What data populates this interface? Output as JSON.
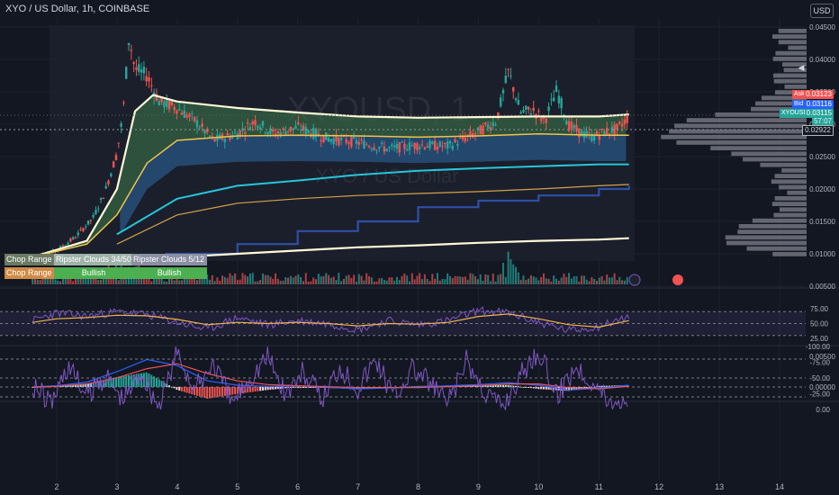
{
  "header": {
    "title": "XYO / US Dollar, 1h, COINBASE",
    "currency_button": "USD"
  },
  "watermark": {
    "ticker": "XYOUSD, 1",
    "name": "XYO / US Dollar"
  },
  "price_tags": {
    "ask_label": "Ask",
    "ask_value": "0.03123",
    "bid_label": "Bid",
    "bid_value": "0.03116",
    "symbol_label": "XYOUSD",
    "last_value": "0.03115",
    "countdown": "57:07",
    "line_value": "0.02922"
  },
  "overlay_table": {
    "row1": [
      "Chop Range",
      "Ripster Clouds 34/50",
      "Ripster Clouds 5/12"
    ],
    "row2": [
      "Chop Range",
      "Bullish",
      "Bullish"
    ]
  },
  "colors": {
    "background": "#131722",
    "grid": "#1e222d",
    "up": "#26a69a",
    "down": "#ef5350",
    "cloud_green": "#3d7a4a",
    "cloud_blue": "#2e6fb0",
    "ema_white": "#fff9d8",
    "ema_yellow": "#f0c44a",
    "cyan": "#26c6da",
    "navy": "#2f4fa8",
    "rsi": "#7e57c2",
    "rsi_signal": "#f0b44a",
    "macd": "#2962ff",
    "macd_signal": "#ef5350",
    "ask": "#ef5350",
    "bid": "#2962ff",
    "last": "#26a69a"
  },
  "chart_data": [
    {
      "type": "line",
      "name": "price",
      "x_labels": [
        "2",
        "3",
        "4",
        "5",
        "6",
        "7",
        "8",
        "9",
        "10",
        "11",
        "12",
        "13",
        "14"
      ],
      "y_labels": [
        "0.04500",
        "0.04000",
        "0.03500",
        "0.03000",
        "0.02500",
        "0.02000",
        "0.01500",
        "0.01000",
        "0.00500"
      ],
      "ylim": [
        0.004,
        0.046
      ],
      "x": [
        1.6,
        2.0,
        2.3,
        2.6,
        2.8,
        3.0,
        3.1,
        3.2,
        3.3,
        3.5,
        3.7,
        4.0,
        4.3,
        4.6,
        5.0,
        5.3,
        5.6,
        6.0,
        6.5,
        7.0,
        7.5,
        8.0,
        8.5,
        9.0,
        9.3,
        9.5,
        9.7,
        9.9,
        10.1,
        10.3,
        10.5,
        10.7,
        10.9,
        11.1,
        11.3,
        11.5
      ],
      "y": [
        0.0095,
        0.0105,
        0.0125,
        0.0155,
        0.0195,
        0.0255,
        0.0315,
        0.0435,
        0.0385,
        0.0375,
        0.0335,
        0.0325,
        0.0305,
        0.0275,
        0.0285,
        0.0305,
        0.0285,
        0.0295,
        0.0278,
        0.0272,
        0.0262,
        0.0268,
        0.0266,
        0.0288,
        0.0305,
        0.0382,
        0.0318,
        0.0322,
        0.0305,
        0.0352,
        0.0298,
        0.0286,
        0.028,
        0.0288,
        0.0292,
        0.0312
      ],
      "overlays": [
        {
          "name": "white",
          "x": [
            1.6,
            2.5,
            3.0,
            3.3,
            3.6,
            4.0,
            5.0,
            6.0,
            7.0,
            8.0,
            9.0,
            10.0,
            11.0,
            11.5
          ],
          "y": [
            0.0095,
            0.012,
            0.02,
            0.032,
            0.0345,
            0.0335,
            0.0325,
            0.0318,
            0.0312,
            0.031,
            0.0311,
            0.0312,
            0.0312,
            0.0315
          ]
        },
        {
          "name": "yellow",
          "x": [
            1.6,
            2.5,
            3.0,
            3.5,
            4.0,
            5.0,
            6.0,
            7.0,
            8.0,
            9.0,
            10.0,
            11.0,
            11.5
          ],
          "y": [
            0.0095,
            0.0115,
            0.016,
            0.024,
            0.0275,
            0.0282,
            0.0283,
            0.0282,
            0.028,
            0.0282,
            0.0285,
            0.0283,
            0.0283
          ]
        },
        {
          "name": "cyan",
          "x": [
            3.0,
            4.0,
            5.0,
            6.0,
            7.0,
            8.0,
            9.0,
            10.0,
            11.0,
            11.5
          ],
          "y": [
            0.013,
            0.0185,
            0.0205,
            0.0213,
            0.0222,
            0.0228,
            0.0232,
            0.0235,
            0.0238,
            0.0238
          ]
        },
        {
          "name": "orange",
          "x": [
            3.0,
            4.0,
            5.0,
            6.0,
            7.0,
            8.0,
            9.0,
            10.0,
            11.0,
            11.5
          ],
          "y": [
            0.0115,
            0.016,
            0.0178,
            0.0185,
            0.019,
            0.0193,
            0.0196,
            0.02,
            0.0205,
            0.0207
          ]
        },
        {
          "name": "navy",
          "x": [
            3.8,
            5.0,
            6.0,
            7.0,
            8.0,
            9.0,
            10.0,
            11.0,
            11.5
          ],
          "y": [
            0.01,
            0.0115,
            0.0135,
            0.015,
            0.0172,
            0.0182,
            0.019,
            0.02,
            0.0205
          ]
        },
        {
          "name": "low-white",
          "x": [
            1.6,
            3.0,
            4.0,
            5.0,
            6.0,
            7.0,
            8.0,
            9.0,
            10.0,
            11.0,
            11.5
          ],
          "y": [
            0.0092,
            0.0093,
            0.0095,
            0.01,
            0.0105,
            0.011,
            0.0113,
            0.0117,
            0.012,
            0.0122,
            0.0124
          ]
        }
      ]
    },
    {
      "type": "line",
      "name": "rsi",
      "y_labels": [
        "75.00",
        "50.00",
        "25.00"
      ],
      "ylim": [
        10,
        90
      ],
      "x": [
        1.6,
        2.0,
        2.5,
        3.0,
        3.5,
        4.0,
        4.5,
        5.0,
        5.5,
        6.0,
        6.5,
        7.0,
        7.5,
        8.0,
        8.5,
        9.0,
        9.5,
        10.0,
        10.5,
        11.0,
        11.5
      ],
      "y": [
        55,
        68,
        62,
        70,
        65,
        52,
        40,
        60,
        48,
        55,
        50,
        40,
        55,
        48,
        55,
        72,
        68,
        52,
        38,
        45,
        62
      ],
      "signal": [
        52,
        58,
        60,
        64,
        63,
        57,
        48,
        52,
        50,
        52,
        50,
        46,
        50,
        49,
        52,
        62,
        66,
        58,
        48,
        44,
        55
      ]
    },
    {
      "type": "bar",
      "name": "macd",
      "y_labels": [
        "0.00500",
        "0.00000"
      ],
      "ylim": [
        -0.002,
        0.006
      ],
      "x": [
        1.6,
        2.0,
        2.5,
        3.0,
        3.5,
        4.0,
        4.5,
        5.0,
        5.5,
        6.0,
        7.0,
        8.0,
        9.0,
        9.5,
        10.0,
        10.5,
        11.0,
        11.5
      ],
      "macd": [
        0.0,
        0.0002,
        0.0008,
        0.0025,
        0.0045,
        0.0035,
        0.001,
        0.0003,
        0.0001,
        0.0002,
        -0.0003,
        0.0,
        0.0004,
        0.0007,
        0.0003,
        -0.0005,
        -0.0002,
        0.0003
      ],
      "signal": [
        0.0,
        0.0001,
        0.0005,
        0.0015,
        0.003,
        0.0038,
        0.0022,
        0.001,
        0.0004,
        0.0002,
        -0.0001,
        -0.0001,
        0.0002,
        0.0005,
        0.0005,
        -0.0001,
        -0.0003,
        0.0001
      ]
    },
    {
      "type": "line",
      "name": "oscillator",
      "y_labels": [
        "0.00",
        "-25.00",
        "-50.00",
        "-75.00",
        "-100.00"
      ],
      "ylim": [
        -105,
        5
      ],
      "x": [
        1.6,
        1.9,
        2.2,
        2.5,
        2.8,
        3.1,
        3.4,
        3.7,
        4.0,
        4.3,
        4.6,
        4.9,
        5.2,
        5.5,
        5.8,
        6.1,
        6.4,
        6.7,
        7.0,
        7.3,
        7.6,
        7.9,
        8.2,
        8.5,
        8.8,
        9.1,
        9.4,
        9.7,
        10.0,
        10.3,
        10.6,
        10.9,
        11.2,
        11.5
      ],
      "y": [
        -40,
        -10,
        -70,
        -20,
        -55,
        -15,
        -60,
        -5,
        -90,
        -30,
        -75,
        -10,
        -50,
        -85,
        -25,
        -60,
        -15,
        -70,
        -35,
        -80,
        -20,
        -65,
        -40,
        -10,
        -75,
        -30,
        -5,
        -55,
        -95,
        -20,
        -70,
        -45,
        -10,
        -20
      ]
    }
  ]
}
